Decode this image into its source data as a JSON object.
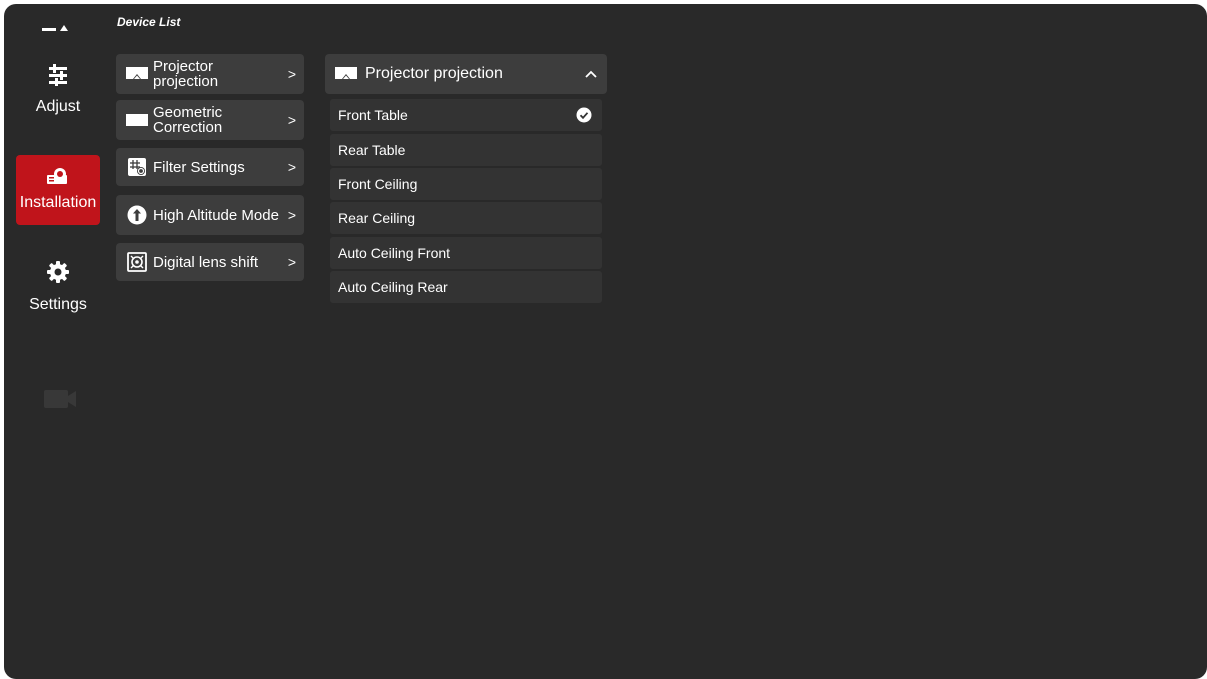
{
  "header": {
    "title": "Device List"
  },
  "sidebar": {
    "items": [
      {
        "label": "Adjust",
        "icon": "sliders-icon",
        "selected": false
      },
      {
        "label": "Installation",
        "icon": "projector-icon",
        "selected": true
      },
      {
        "label": "Settings",
        "icon": "gear-icon",
        "selected": false
      }
    ]
  },
  "menu": {
    "items": [
      {
        "label": "Projector projection",
        "icon": "projection-icon"
      },
      {
        "label": "Geometric Correction",
        "icon": "rectangle-icon"
      },
      {
        "label": "Filter Settings",
        "icon": "filter-icon"
      },
      {
        "label": "High Altitude Mode",
        "icon": "altitude-icon"
      },
      {
        "label": "Digital lens shift",
        "icon": "lens-shift-icon"
      }
    ]
  },
  "dropdown": {
    "title": "Projector projection",
    "selected": "Front Table",
    "options": [
      "Front Table",
      "Rear Table",
      "Front Ceiling",
      "Rear Ceiling",
      "Auto Ceiling Front",
      "Auto Ceiling Rear"
    ]
  },
  "colors": {
    "background": "#292929",
    "panel": "#3d3d3d",
    "option": "#333333",
    "accent": "#c0141b"
  }
}
